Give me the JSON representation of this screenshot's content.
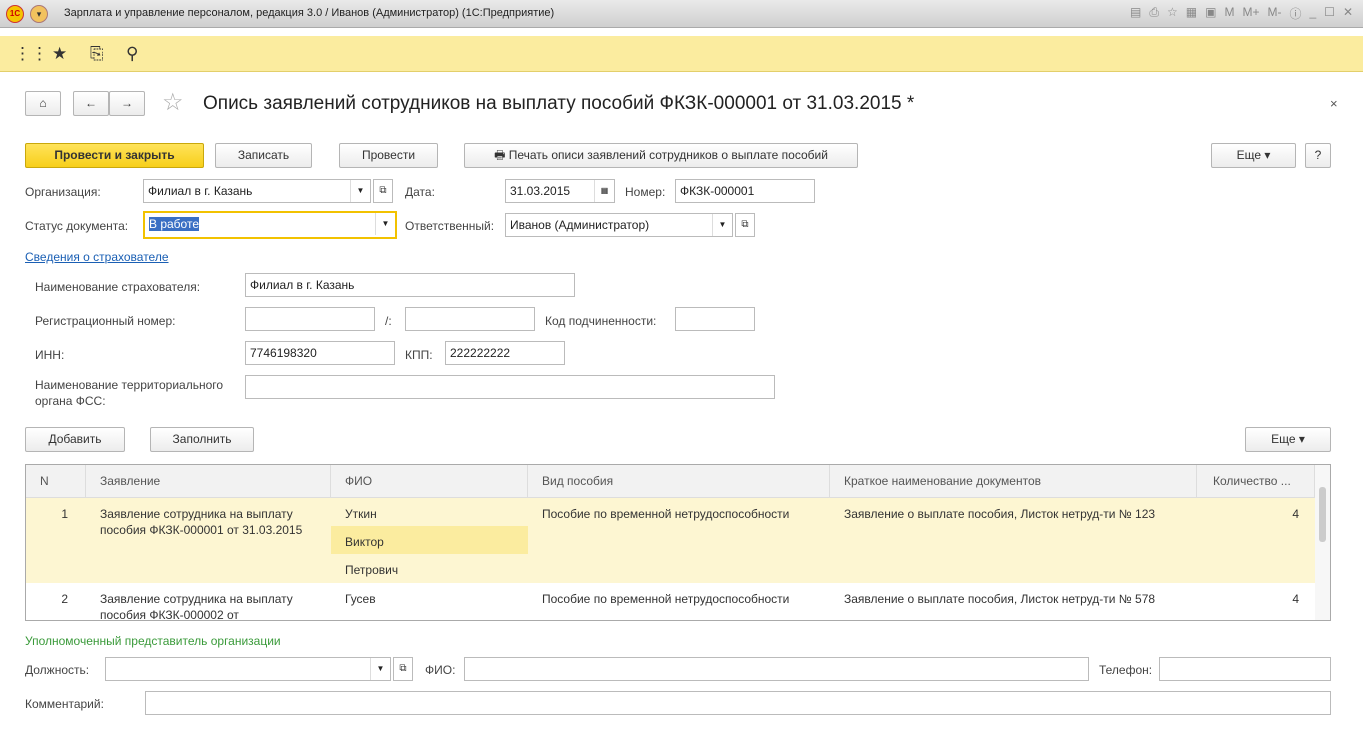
{
  "window": {
    "title": "Зарплата и управление персоналом, редакция 3.0 / Иванов (Администратор)  (1С:Предприятие)",
    "logo": "1С"
  },
  "header": {
    "title": "Опись заявлений сотрудников на выплату пособий ФКЗК-000001 от 31.03.2015 *"
  },
  "actions": {
    "post_close": "Провести и закрыть",
    "save": "Записать",
    "post": "Провести",
    "print": "Печать описи заявлений сотрудников о выплате пособий",
    "more": "Еще",
    "help": "?"
  },
  "form": {
    "org_label": "Организация:",
    "org": "Филиал в г. Казань",
    "date_label": "Дата:",
    "date": "31.03.2015",
    "num_label": "Номер:",
    "num": "ФКЗК-000001",
    "status_label": "Статус документа:",
    "status": "В работе",
    "resp_label": "Ответственный:",
    "resp": "Иванов (Администратор)"
  },
  "insurer": {
    "link": "Сведения о страхователе",
    "name_label": "Наименование страхователя:",
    "name": "Филиал в г. Казань",
    "reg_label": "Регистрационный номер:",
    "reg": "",
    "reg2": "",
    "slash": "/:",
    "sub_label": "Код подчиненности:",
    "sub": "",
    "inn_label": "ИНН:",
    "inn": "7746198320",
    "kpp_label": "КПП:",
    "kpp": "222222222",
    "fss_label": "Наименование территориального органа ФСС:",
    "fss": ""
  },
  "table": {
    "add": "Добавить",
    "fill": "Заполнить",
    "more": "Еще",
    "columns": [
      "N",
      "Заявление",
      "ФИО",
      "Вид пособия",
      "Краткое наименование документов",
      "Количество ..."
    ],
    "rows": [
      {
        "n": "1",
        "app": "Заявление сотрудника на выплату пособия ФКЗК-000001 от 31.03.2015",
        "fio": [
          "Уткин",
          "Виктор",
          "Петрович"
        ],
        "kind": "Пособие по временной нетрудоспособности",
        "docs": "Заявление о выплате пособия, Листок нетруд-ти № 123",
        "qty": "4"
      },
      {
        "n": "2",
        "app": "Заявление сотрудника на выплату пособия ФКЗК-000002 от",
        "fio": [
          "Гусев"
        ],
        "kind": "Пособие по временной нетрудоспособности",
        "docs": "Заявление о выплате пособия, Листок нетруд-ти № 578",
        "qty": "4"
      }
    ]
  },
  "rep": {
    "title": "Уполномоченный представитель организации",
    "pos_label": "Должность:",
    "pos": "",
    "fio_label": "ФИО:",
    "fio": "",
    "phone_label": "Телефон:",
    "phone": ""
  },
  "comment": {
    "label": "Комментарий:",
    "value": ""
  }
}
